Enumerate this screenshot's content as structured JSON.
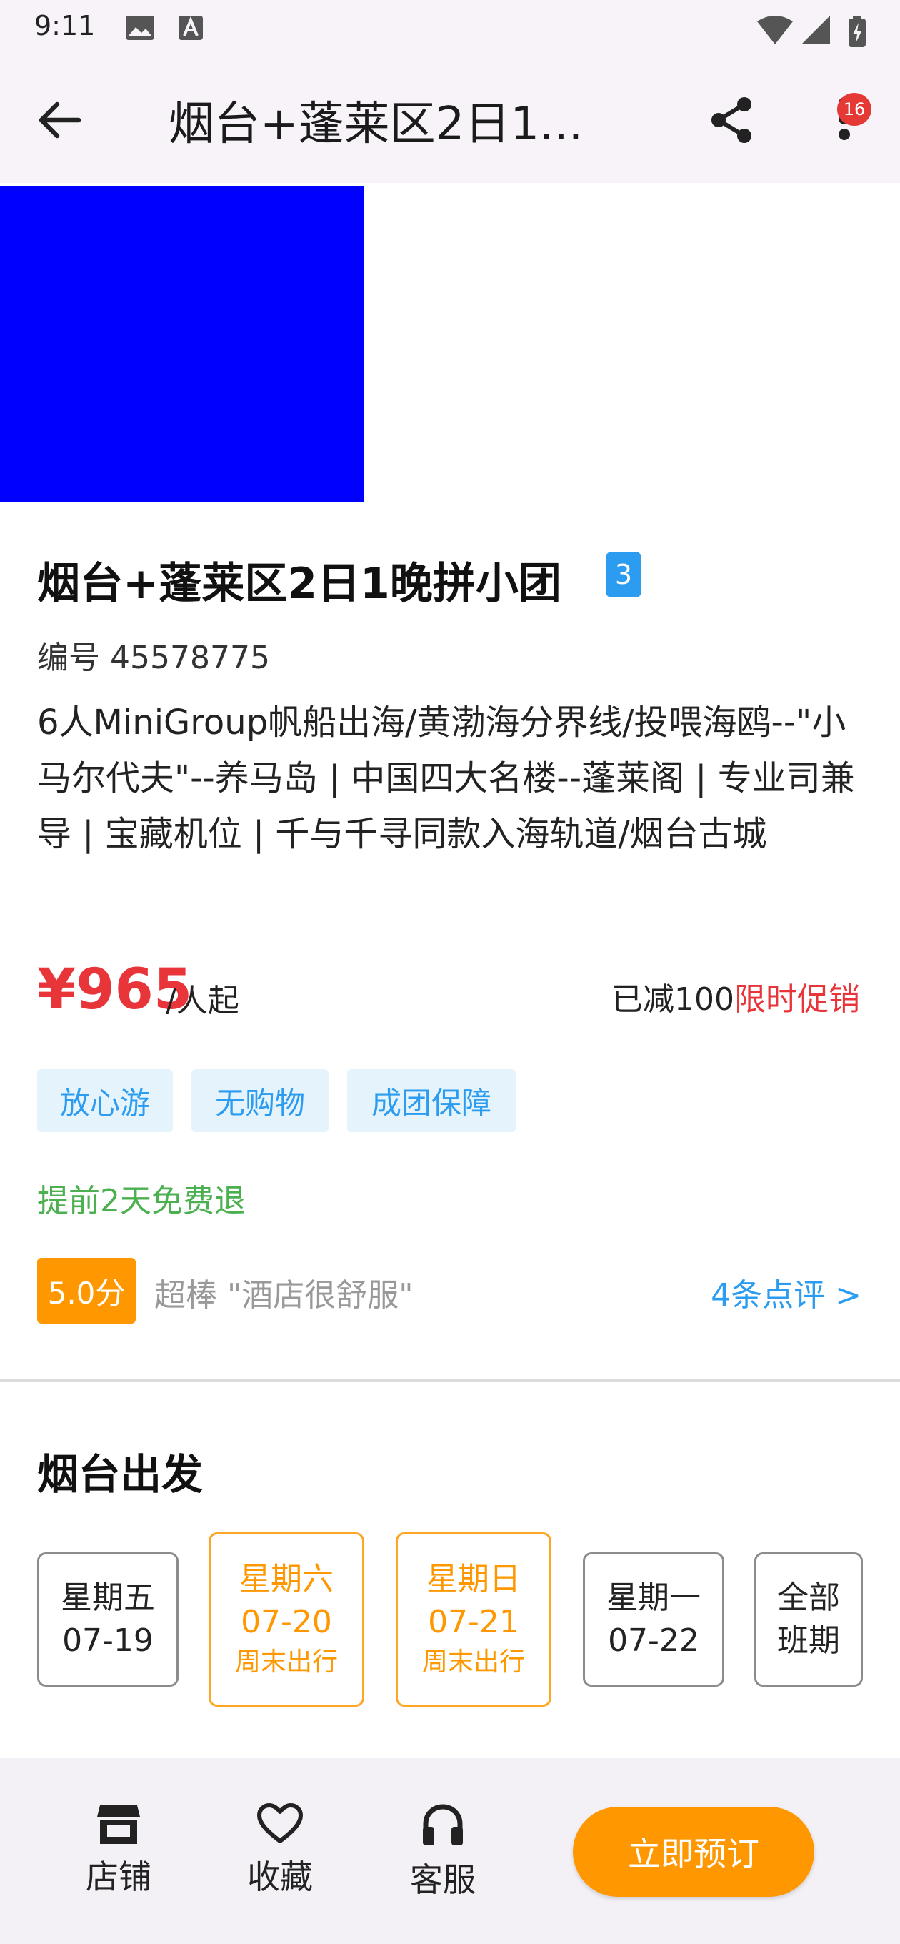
{
  "status_bar": {
    "time": "9:11"
  },
  "header": {
    "title": "烟台+蓬莱区2日1...",
    "notification_count": "16"
  },
  "product": {
    "title": "烟台+蓬莱区2日1晚拼小团",
    "title_badge": "3",
    "id_text": "编号 45578775",
    "description": "6人MiniGroup帆船出海/黄渤海分界线/投喂海鸥--\"小马尔代夫\"--养马岛 | 中国四大名楼--蓬莱阁 | 专业司兼导 | 宝藏机位 | 千与千寻同款入海轨道/烟台古城",
    "price": "¥965",
    "price_unit": "/人起",
    "discount_text": "已减100",
    "promo_text": "限时促销",
    "tags": [
      "放心游",
      "无购物",
      "成团保障"
    ],
    "refund_policy": "提前2天免费退"
  },
  "rating": {
    "score": "5.0分",
    "summary": "超棒 \"酒店很舒服\"",
    "reviews_link": "4条点评 >"
  },
  "departure": {
    "title": "烟台出发",
    "dates": [
      {
        "day": "星期五",
        "date": "07-19",
        "note": ""
      },
      {
        "day": "星期六",
        "date": "07-20",
        "note": "周末出行"
      },
      {
        "day": "星期日",
        "date": "07-21",
        "note": "周末出行"
      },
      {
        "day": "星期一",
        "date": "07-22",
        "note": ""
      },
      {
        "day": "全部",
        "date": "班期",
        "note": ""
      }
    ]
  },
  "bottom_bar": {
    "shop_label": "店铺",
    "favorite_label": "收藏",
    "service_label": "客服",
    "book_label": "立即预订"
  },
  "colors": {
    "price_red": "#e8353a",
    "accent_blue": "#2b9cf0",
    "accent_orange": "#ff9800",
    "refund_green": "#4caf50",
    "hero_image": "#0000ff"
  },
  "icons": {
    "back": "arrow-left-icon",
    "share": "share-icon",
    "more": "more-vertical-icon",
    "shop": "store-icon",
    "favorite": "heart-icon",
    "service": "headset-icon"
  }
}
